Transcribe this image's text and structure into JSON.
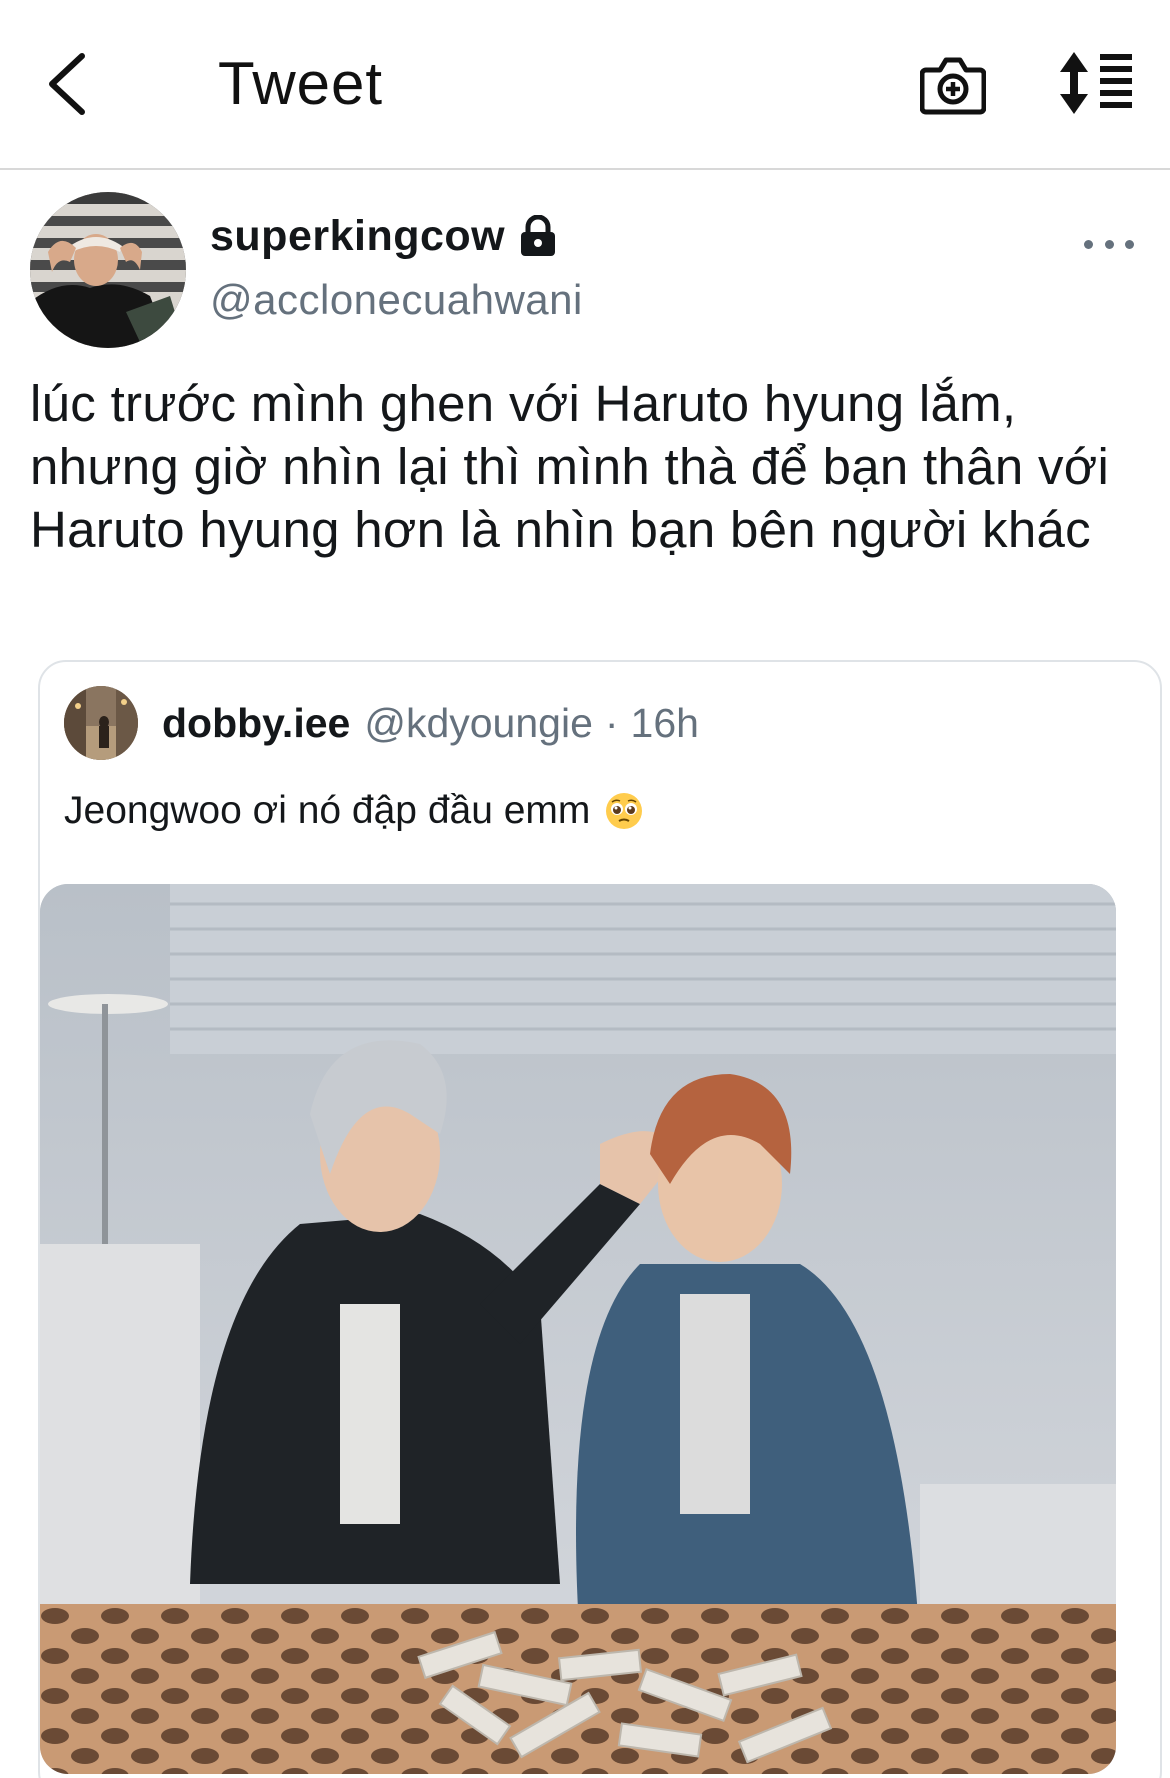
{
  "header": {
    "title": "Tweet",
    "back_icon": "chevron-left-icon",
    "camera_icon": "camera-plus-icon",
    "sort_icon": "sort-list-icon"
  },
  "tweet": {
    "author_name": "superkingcow",
    "author_handle": "@acclonecuahwani",
    "protected_icon": "lock-icon",
    "more_icon": "more-horizontal-icon",
    "text": "lúc trước mình ghen với Haruto hyung lắm, nhưng giờ nhìn lại thì mình thà để bạn thân với Haruto hyung hơn là nhìn bạn bên người khác"
  },
  "quote": {
    "author_name": "dobby.iee",
    "author_handle": "@kdyoungie",
    "separator": "·",
    "time": "16h",
    "text": "Jeongwoo ơi nó đập đầu emm",
    "emoji": "pleading-face-emoji"
  },
  "colors": {
    "text_primary": "#14171a",
    "text_secondary": "#65717d",
    "border": "#dfe3e7"
  }
}
